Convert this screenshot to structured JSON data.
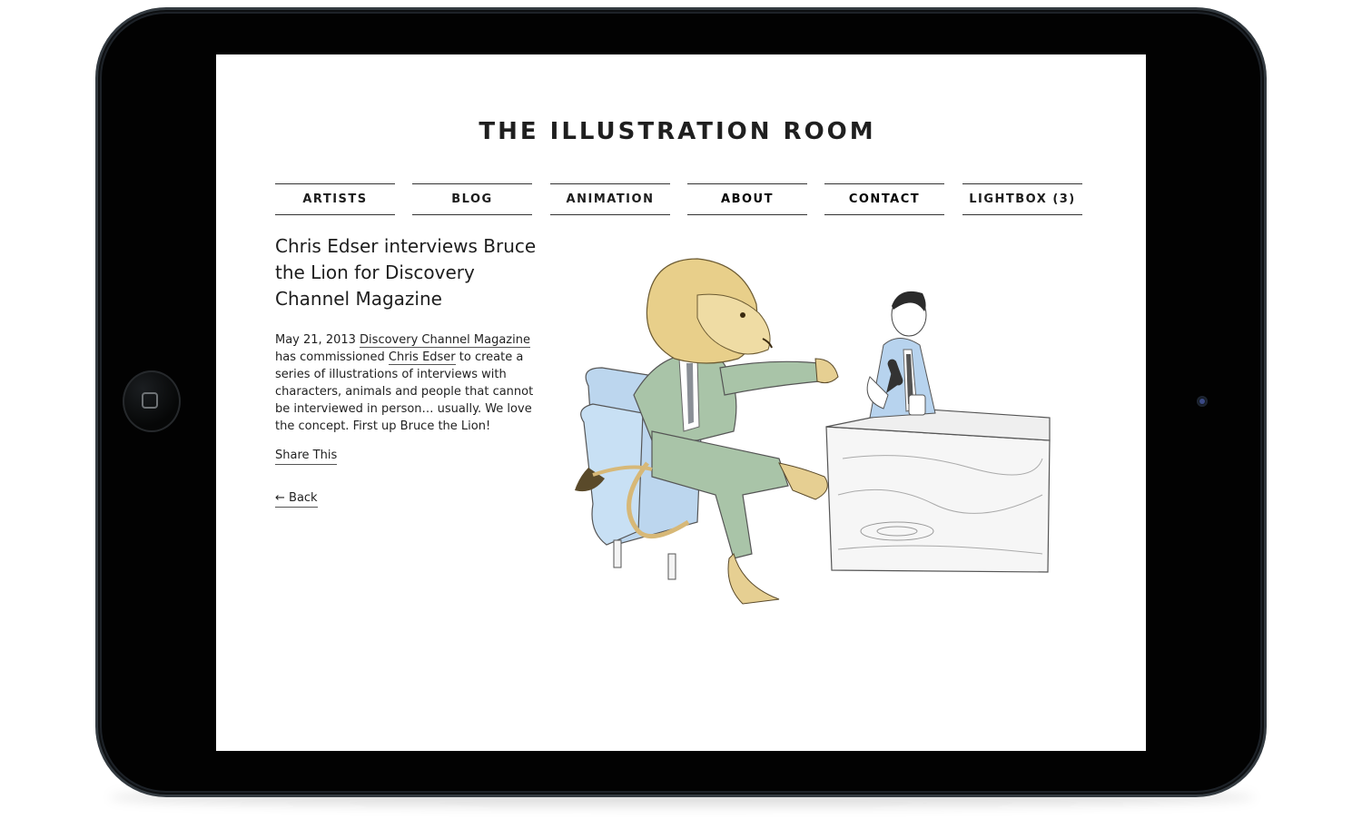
{
  "site": {
    "title": "THE ILLUSTRATION ROOM"
  },
  "nav": {
    "items": [
      {
        "label": "ARTISTS"
      },
      {
        "label": "BLOG"
      },
      {
        "label": "ANIMATION"
      },
      {
        "label": "ABOUT"
      },
      {
        "label": "CONTACT"
      },
      {
        "label": "LIGHTBOX (3)"
      }
    ]
  },
  "post": {
    "title": "Chris Edser interviews Bruce the Lion for Discovery Channel Magazine",
    "date": "May 21, 2013",
    "magazine_link": "Discovery Channel Magazine",
    "text_1": " has commissioned ",
    "artist_link": "Chris Edser",
    "text_2": " to create a series of illustrations of interviews with characters, animals and people that cannot be interviewed in person… usually. We love the concept. First up Bruce the Lion!",
    "share_label": "Share This",
    "back_label": "← Back"
  },
  "colors": {
    "lion_mane": "#e8cf8a",
    "suit_green": "#a9c4a8",
    "chair_blue": "#bcd6ee",
    "host_suit": "#b7d3ee"
  }
}
